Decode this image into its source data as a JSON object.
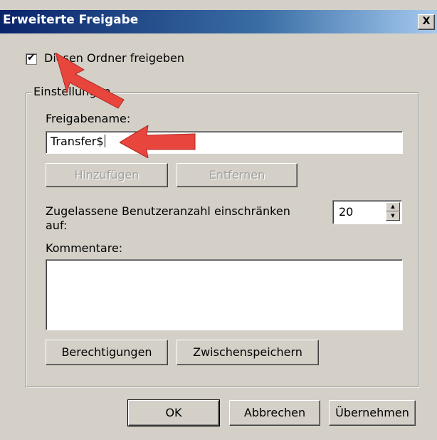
{
  "window": {
    "title": "Erweiterte Freigabe",
    "close_label": "X"
  },
  "share_checkbox": {
    "label": "Diesen Ordner freigeben",
    "checked": true,
    "mark": "✔"
  },
  "settings_group": {
    "label": "Einstellungen",
    "share_name_label": "Freigabename:",
    "share_name_value": "Transfer$",
    "add_button": "Hinzufügen",
    "remove_button": "Entfernen",
    "user_limit_label_line1": "Zugelassene Benutzeranzahl einschränken",
    "user_limit_label_line2": "auf:",
    "user_limit_value": "20",
    "comments_label": "Kommentare:",
    "comments_value": "",
    "permissions_button": "Berechtigungen",
    "caching_button": "Zwischenspeichern"
  },
  "footer": {
    "ok_button": "OK",
    "cancel_button": "Abbrechen",
    "apply_button": "Übernehmen"
  },
  "annotations": {
    "arrow_color": "#e8453c",
    "arrow_icon": "red-arrow-icon"
  }
}
